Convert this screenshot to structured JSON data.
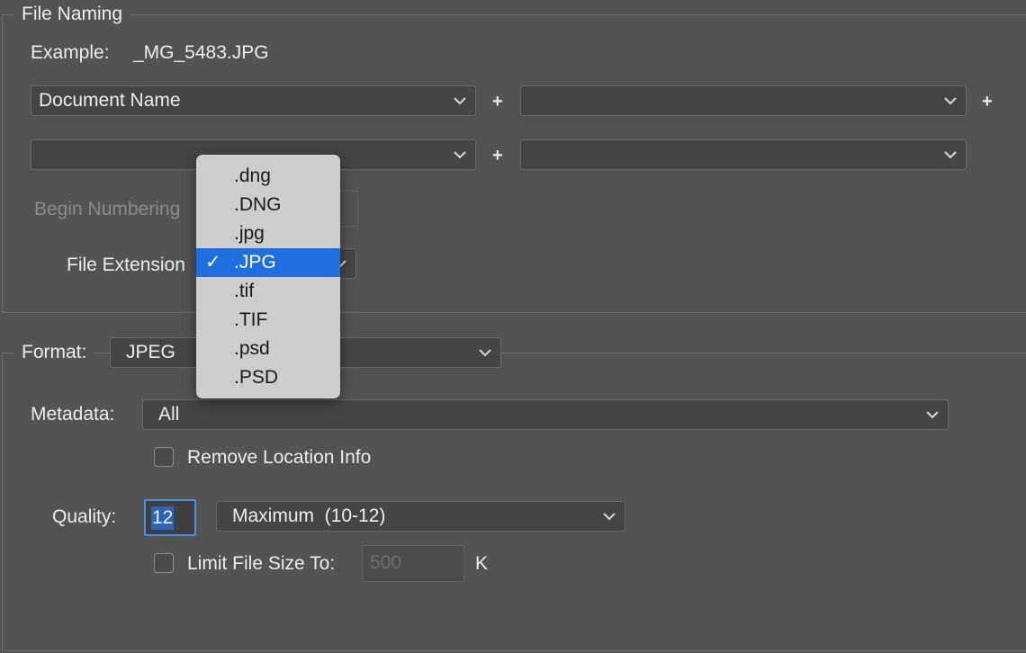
{
  "file_naming": {
    "legend": "File Naming",
    "example_label": "Example:",
    "example_value": "_MG_5483.JPG",
    "name_fields": [
      {
        "value": "Document Name"
      },
      {
        "value": ""
      },
      {
        "value": ""
      },
      {
        "value": ""
      }
    ],
    "plus": "+",
    "begin_numbering_label": "Begin Numbering",
    "file_extension_label": "File Extension",
    "extension_menu": {
      "items": [
        ".dng",
        ".DNG",
        ".jpg",
        ".JPG",
        ".tif",
        ".TIF",
        ".psd",
        ".PSD"
      ],
      "selected": ".JPG",
      "check_glyph": "✓"
    }
  },
  "format": {
    "label": "Format:",
    "value": "JPEG"
  },
  "metadata": {
    "label": "Metadata:",
    "value": "All"
  },
  "remove_location": {
    "label": "Remove Location Info",
    "checked": false
  },
  "quality": {
    "label": "Quality:",
    "value": "12",
    "preset": "Maximum  (10-12)"
  },
  "limit_file_size": {
    "label": "Limit File Size To:",
    "checked": false,
    "value": "500",
    "unit": "K"
  },
  "icons": {
    "dropdown": "chevron-down-icon",
    "check": "checkmark-icon"
  },
  "colors": {
    "background": "#535353",
    "menu_bg": "#cdcdcd",
    "highlight": "#1f6fe0",
    "focus_ring": "#4a8fe0"
  }
}
